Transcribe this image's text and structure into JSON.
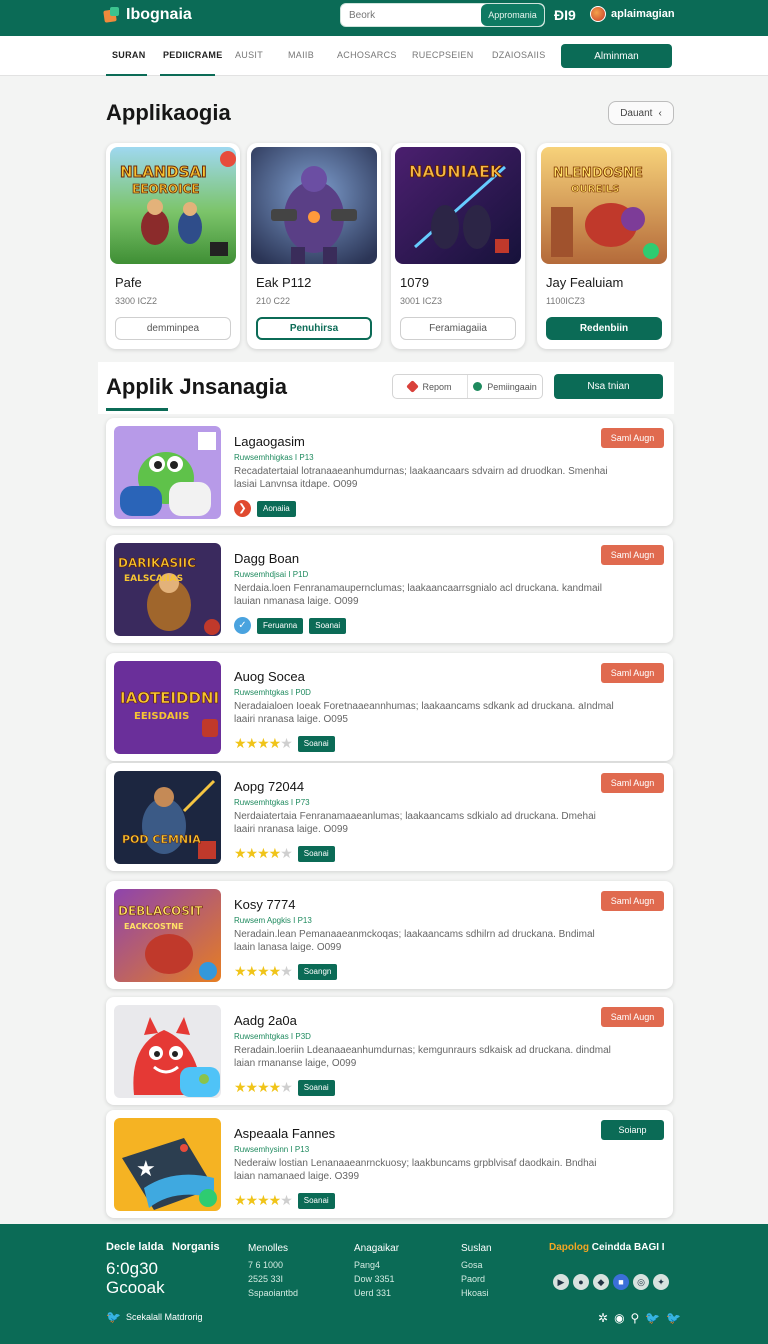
{
  "header": {
    "logo_text": "Ibognaia",
    "search_placeholder": "Beork",
    "search_button": "Appromania",
    "count": "ÐI9",
    "user_name": "aplaimagian"
  },
  "nav": {
    "items": [
      "SURAN",
      "PEDIICRAME",
      "AUSIT",
      "MAIIB",
      "ACHOSARCS",
      "RUECPSEIEN",
      "DZAIOSAIIS"
    ],
    "cta": "Alminman"
  },
  "featured": {
    "title": "Applikaogia",
    "filter_label": "Dauant",
    "cards": [
      {
        "name": "Pafe",
        "meta": "3300 ICZ2",
        "button": "demminpea",
        "style": "ghost",
        "art": "NLANDSAI\nEEOROICE"
      },
      {
        "name": "Eak P112",
        "meta": "210 C22",
        "button": "Penuhirsa",
        "style": "outline",
        "art": ""
      },
      {
        "name": "1079",
        "meta": "3001 ICZ3",
        "button": "Feramiagaiia",
        "style": "ghost",
        "art": "NAUNIAEK"
      },
      {
        "name": "Jay Fealuiam",
        "meta": "1100ICZ3",
        "button": "Redenbiin",
        "style": "solid",
        "art": "NLENDOSNE\nOUREILS"
      }
    ]
  },
  "list": {
    "title": "Applik Jnsanagia",
    "segment": [
      "Repom",
      "Pemiingaain"
    ],
    "cta": "Nsa tnian",
    "apps": [
      {
        "name": "Lagaogasim",
        "sub": "Ruwsemhhigkas I P13",
        "desc": "Recadatertaial lotranaaeanhumdurnas; laakaancaars sdvairn ad druodkan. Smenhai lasiai Lanvnsa itdape. O099",
        "rating": 0,
        "foot_icon": "red",
        "tag": "Aonaiia",
        "action": "Saml Augn",
        "action_color": "#e06a4f",
        "art": ""
      },
      {
        "name": "Dagg Boan",
        "sub": "Ruwsemhdjsai I P1D",
        "desc": "Nerdaia.loen Fenranamaupernclumas; laakaancaarrsgnialo acl druckana. kandmail lauian nmanasa laige. O099",
        "rating": 0,
        "foot_icon": "blue",
        "tag": "Feruanna",
        "tag2": "Soanai",
        "action": "Saml Augn",
        "action_color": "#e06a4f",
        "art": "DARIKASIIC\nEALSCAIIAS"
      },
      {
        "name": "Auog Socea",
        "sub": "Ruwsemhtgkas I P0D",
        "desc": "Neradaialoen Ioeak Foretnaaeannhumas; laakaancams sdkank ad druckana. aIndmal laairi nranasa laige. O095",
        "rating": 4,
        "tag": "Soanai",
        "action": "Saml Augn",
        "action_color": "#e06a4f",
        "art": "IAOTEIDDNI\nEEISDAIIS"
      },
      {
        "name": "Aopg 72044",
        "sub": "Ruwsemhtgkas I P73",
        "desc": "Nerdaiatertaia Fenranamaaeanlumas; laakaancams sdkialo ad druckana. Dmehai laairi nranasa laige. O099",
        "rating": 4,
        "tag": "Soanai",
        "action": "Saml Augn",
        "action_color": "#e06a4f",
        "art": "POD CEMNIA\nESAIARIE"
      },
      {
        "name": "Kosy 7774",
        "sub": "Ruwsem Apgkis I P13",
        "desc": "Neradain.lean Pemanaaeanmckoqas; laakaancams sdhilrn ad druckana. Bndimal laain lanasa laige. O099",
        "rating": 4,
        "tag": "Soangn",
        "action": "Saml Augn",
        "action_color": "#e06a4f",
        "art": "DEBLACOSIT\nEACKCOSTNE"
      },
      {
        "name": "Aadg 2a0a",
        "sub": "Ruwsemhtgkas I P3D",
        "desc": "Reradain.loeriin Ldeanaaeanhumdurnas; kemgunraurs sdkaisk ad druckana. dindmal laian rmananse laige, O099",
        "rating": 4,
        "tag": "Soanai",
        "action": "Saml Augn",
        "action_color": "#e06a4f",
        "art": ""
      },
      {
        "name": "Aspeaala Fannes",
        "sub": "Ruwsemhysinn I P13",
        "desc": "Nederaiw lostian Lenanaaeanrnckuosy; laakbuncams grpblvisaf daodkain. Bndhai laian namanaed laige. O399",
        "rating": 4,
        "tag": "Soanai",
        "action": "Soianp",
        "action_color": "#0b6b56",
        "art": ""
      }
    ]
  },
  "footer": {
    "brand": "Decle lalda",
    "brand2": "Norganis",
    "big_line1": "6:0g30",
    "big_line2": "Gcooak",
    "social_text": "Scekalall Matdrorig",
    "cols": [
      {
        "head": "Menolles",
        "items": [
          "7 6 1000",
          "2525 33I",
          "Sspaoiantbd"
        ]
      },
      {
        "head": "Anagaikar",
        "items": [
          "Pang4",
          "Dow 3351",
          "Uerd 331"
        ]
      },
      {
        "head": "Suslan",
        "items": [
          "Gosa",
          "Paord",
          "Hkoasi"
        ]
      }
    ],
    "right_accent": "Dapolog",
    "right_title": "Ceindda BAGI I"
  },
  "colors": {
    "brand": "#0b6b56",
    "action_red": "#e06a4f",
    "star": "#f0c419"
  }
}
